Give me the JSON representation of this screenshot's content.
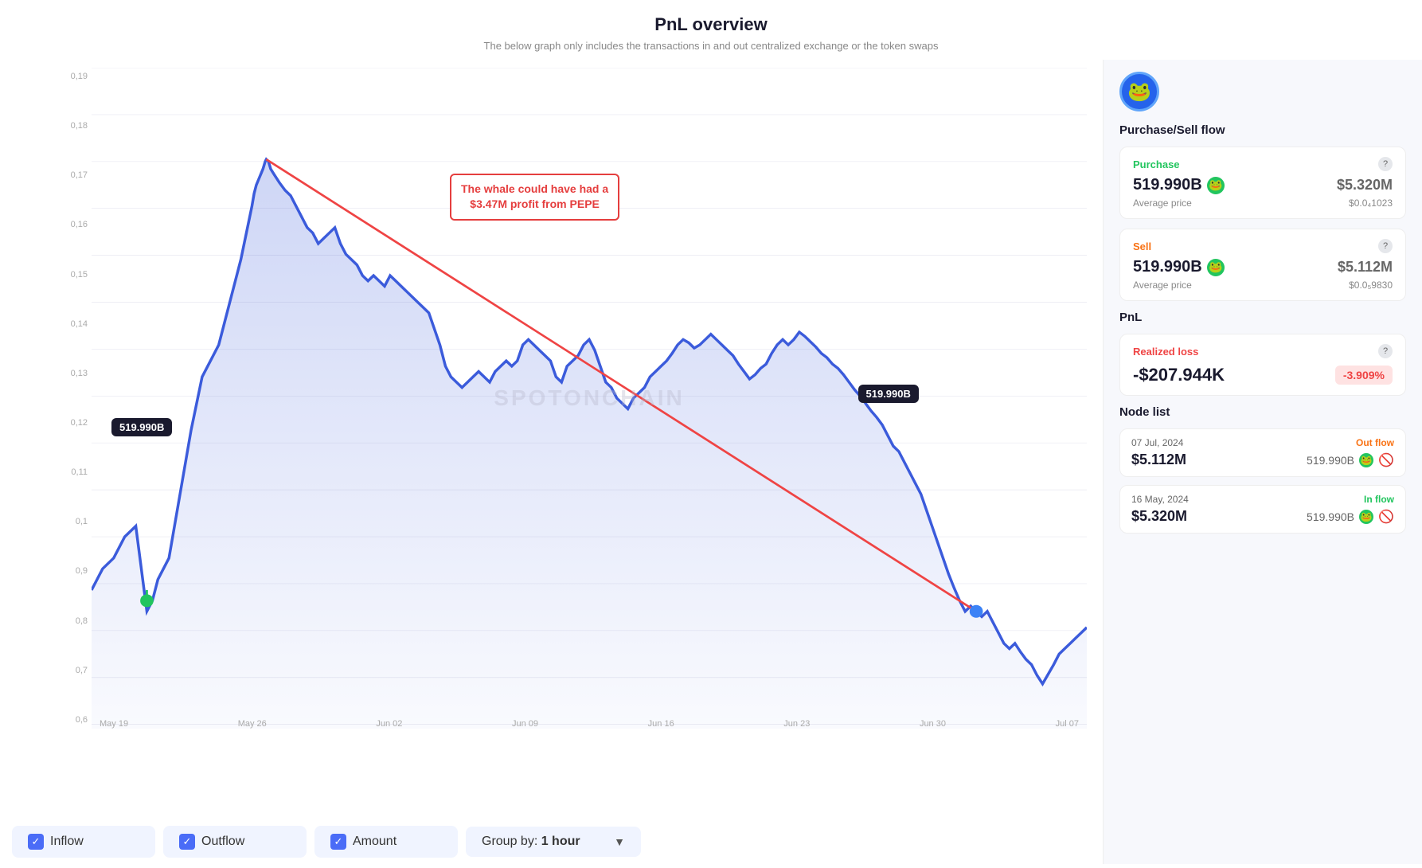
{
  "header": {
    "title": "PnL overview",
    "subtitle": "The below graph only includes the transactions in and out centralized exchange or the token swaps"
  },
  "chart": {
    "annotation": {
      "line1": "The whale could have had a",
      "line2": "$3.47M profit from PEPE"
    },
    "tooltip1": "519.990B",
    "tooltip2": "519.990B",
    "y_labels": [
      "0,19",
      "0,18",
      "0,17",
      "0,16",
      "0,15",
      "0,14",
      "0,13",
      "0,12",
      "0,11",
      "0,1",
      "0,9",
      "0,8",
      "0,7",
      "0,6"
    ],
    "x_labels": [
      "May 19",
      "May 26",
      "Jun 02",
      "Jun 09",
      "Jun 16",
      "Jun 23",
      "Jun 30",
      "Jul 07"
    ],
    "watermark": "SPOTONCHAIN"
  },
  "controls": {
    "inflow_label": "Inflow",
    "outflow_label": "Outflow",
    "amount_label": "Amount",
    "group_prefix": "Group by: ",
    "group_value": "1 hour"
  },
  "right_panel": {
    "token_emoji": "🐸",
    "purchase_sell_title": "Purchase/Sell flow",
    "purchase": {
      "label": "Purchase",
      "amount": "519.990B",
      "usd": "$5.320M",
      "avg_price_label": "Average price",
      "avg_price": "$0.0₄1023"
    },
    "sell": {
      "label": "Sell",
      "amount": "519.990B",
      "usd": "$5.112M",
      "avg_price_label": "Average price",
      "avg_price": "$0.0₅9830"
    },
    "pnl_title": "PnL",
    "realized_loss": {
      "label": "Realized loss",
      "value": "-$207.944K",
      "badge": "-3.909%"
    },
    "node_list_title": "Node list",
    "nodes": [
      {
        "date": "07 Jul, 2024",
        "flow_type": "Out flow",
        "usd": "$5.112M",
        "token_amount": "519.990B"
      },
      {
        "date": "16 May, 2024",
        "flow_type": "In flow",
        "usd": "$5.320M",
        "token_amount": "519.990B"
      }
    ]
  }
}
